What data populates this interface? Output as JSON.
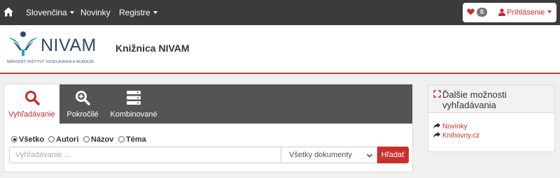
{
  "nav": {
    "language": "Slovenčina",
    "news": "Novinky",
    "registers": "Registre",
    "favorites_count": "0",
    "login": "Prihlásenie"
  },
  "header": {
    "logo_text": "NIVAM",
    "logo_subtitle": "NÁRODNÝ INŠTITÚT VZDELÁVANIA A MLÁDEŽE",
    "title": "Knižnica NIVAM"
  },
  "search": {
    "tabs": [
      {
        "label": "Vyhľadávanie",
        "icon": "search-icon"
      },
      {
        "label": "Pokročilé",
        "icon": "zoom-in-icon"
      },
      {
        "label": "Kombinované",
        "icon": "server-stack-icon"
      }
    ],
    "radios": [
      {
        "label": "Všetko",
        "checked": true
      },
      {
        "label": "Autori",
        "checked": false
      },
      {
        "label": "Názov",
        "checked": false
      },
      {
        "label": "Téma",
        "checked": false
      }
    ],
    "placeholder": "Vyhľadávanie ...",
    "doc_type": "Všetky dokumenty",
    "button": "Hľadať"
  },
  "sidebar": {
    "title": "Ďalšie možnosti vyhľadávania",
    "links": [
      "Novinky",
      "Knihovny.cz"
    ]
  },
  "colors": {
    "accent": "#c9302c",
    "topbar": "#3b3b3b",
    "tabsbar": "#545454",
    "brand": "#2f4a66",
    "brand_teal": "#2aa6a8"
  }
}
